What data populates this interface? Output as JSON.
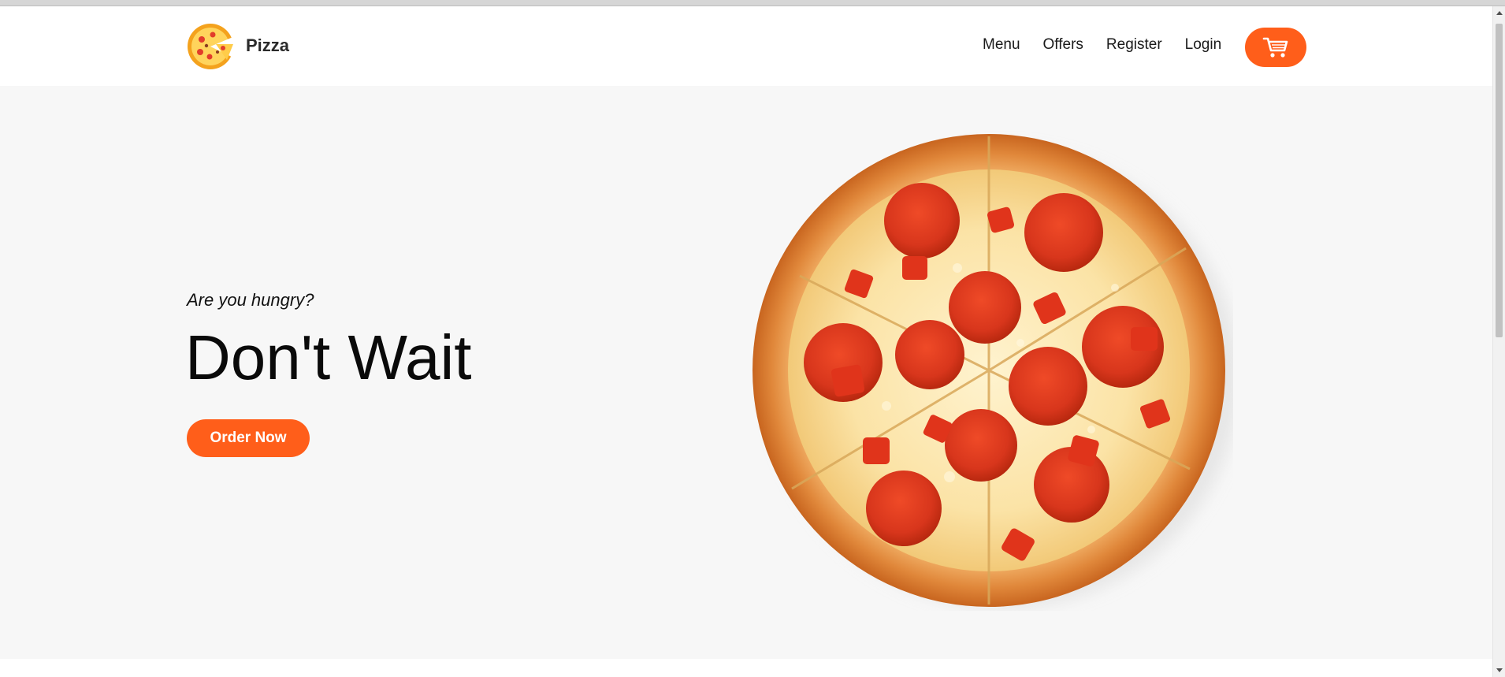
{
  "header": {
    "brand_name": "Pizza",
    "nav": [
      {
        "label": "Menu"
      },
      {
        "label": "Offers"
      },
      {
        "label": "Register"
      },
      {
        "label": "Login"
      }
    ]
  },
  "hero": {
    "subtitle": "Are you hungry?",
    "title": "Don't Wait",
    "cta_label": "Order Now"
  },
  "icons": {
    "logo": "pizza-slice-logo",
    "cart": "cart-icon"
  },
  "colors": {
    "accent": "#ff5e1a",
    "hero_bg": "#f7f7f7",
    "text": "#111111"
  }
}
